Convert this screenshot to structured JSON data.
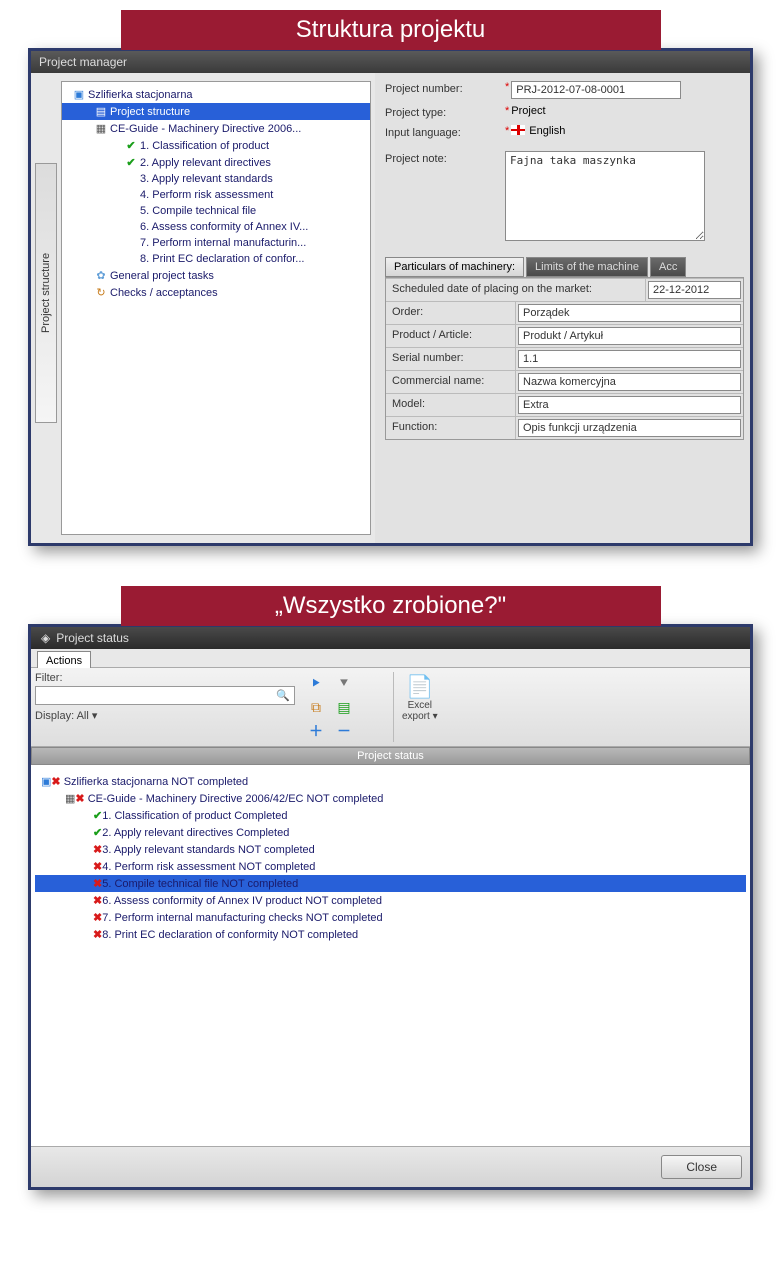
{
  "banner1": "Struktura projektu",
  "banner2": "„Wszystko zrobione?\"",
  "panel1": {
    "title": "Project manager",
    "sideTab": "Project structure",
    "tree": {
      "root": "Szlifierka stacjonarna",
      "n_structure": "Project structure",
      "n_guide": "CE-Guide - Machinery Directive 2006...",
      "steps": [
        "1. Classification of product",
        "2. Apply relevant directives",
        "3. Apply relevant standards",
        "4. Perform risk assessment",
        "5. Compile technical file",
        "6. Assess conformity of Annex IV...",
        "7. Perform internal manufacturin...",
        "8. Print EC declaration of confor..."
      ],
      "n_general": "General project tasks",
      "n_checks": "Checks / acceptances"
    },
    "form": {
      "projectNumber_l": "Project number:",
      "projectNumber_v": "PRJ-2012-07-08-0001",
      "projectType_l": "Project type:",
      "projectType_v": "Project",
      "inputLang_l": "Input language:",
      "inputLang_v": "English",
      "projectNote_l": "Project note:",
      "projectNote_v": "Fajna taka maszynka",
      "tab_part": "Particulars of machinery:",
      "tab_limits": "Limits of the machine",
      "tab_acc": "Acc",
      "sched_l": "Scheduled date of placing on the market:",
      "sched_v": "22-12-2012",
      "order_l": "Order:",
      "order_v": "Porządek",
      "product_l": "Product / Article:",
      "product_v": "Produkt / Artykuł",
      "serial_l": "Serial number:",
      "serial_v": "1.1",
      "comm_l": "Commercial name:",
      "comm_v": "Nazwa komercyjna",
      "model_l": "Model:",
      "model_v": "Extra",
      "func_l": "Function:",
      "func_v": "Opis funkcji urządzenia"
    }
  },
  "panel2": {
    "title": "Project status",
    "tab_actions": "Actions",
    "filter_l": "Filter:",
    "display_l": "Display:",
    "display_v": "All",
    "excel_l1": "Excel",
    "excel_l2": "export",
    "status_hdr": "Project status",
    "close": "Close",
    "tree": {
      "root": "Szlifierka stacjonarna NOT completed",
      "guide": "CE-Guide - Machinery Directive 2006/42/EC NOT completed",
      "steps": [
        {
          "ok": true,
          "t": "1. Classification of product Completed"
        },
        {
          "ok": true,
          "t": "2. Apply relevant directives Completed"
        },
        {
          "ok": false,
          "t": "3. Apply relevant standards NOT completed"
        },
        {
          "ok": false,
          "t": "4. Perform risk assessment NOT completed"
        },
        {
          "ok": false,
          "t": "5. Compile technical file NOT completed",
          "sel": true
        },
        {
          "ok": false,
          "t": "6. Assess conformity of Annex IV product NOT completed"
        },
        {
          "ok": false,
          "t": "7. Perform internal manufacturing checks NOT completed"
        },
        {
          "ok": false,
          "t": "8. Print EC declaration of conformity NOT completed"
        }
      ]
    }
  }
}
